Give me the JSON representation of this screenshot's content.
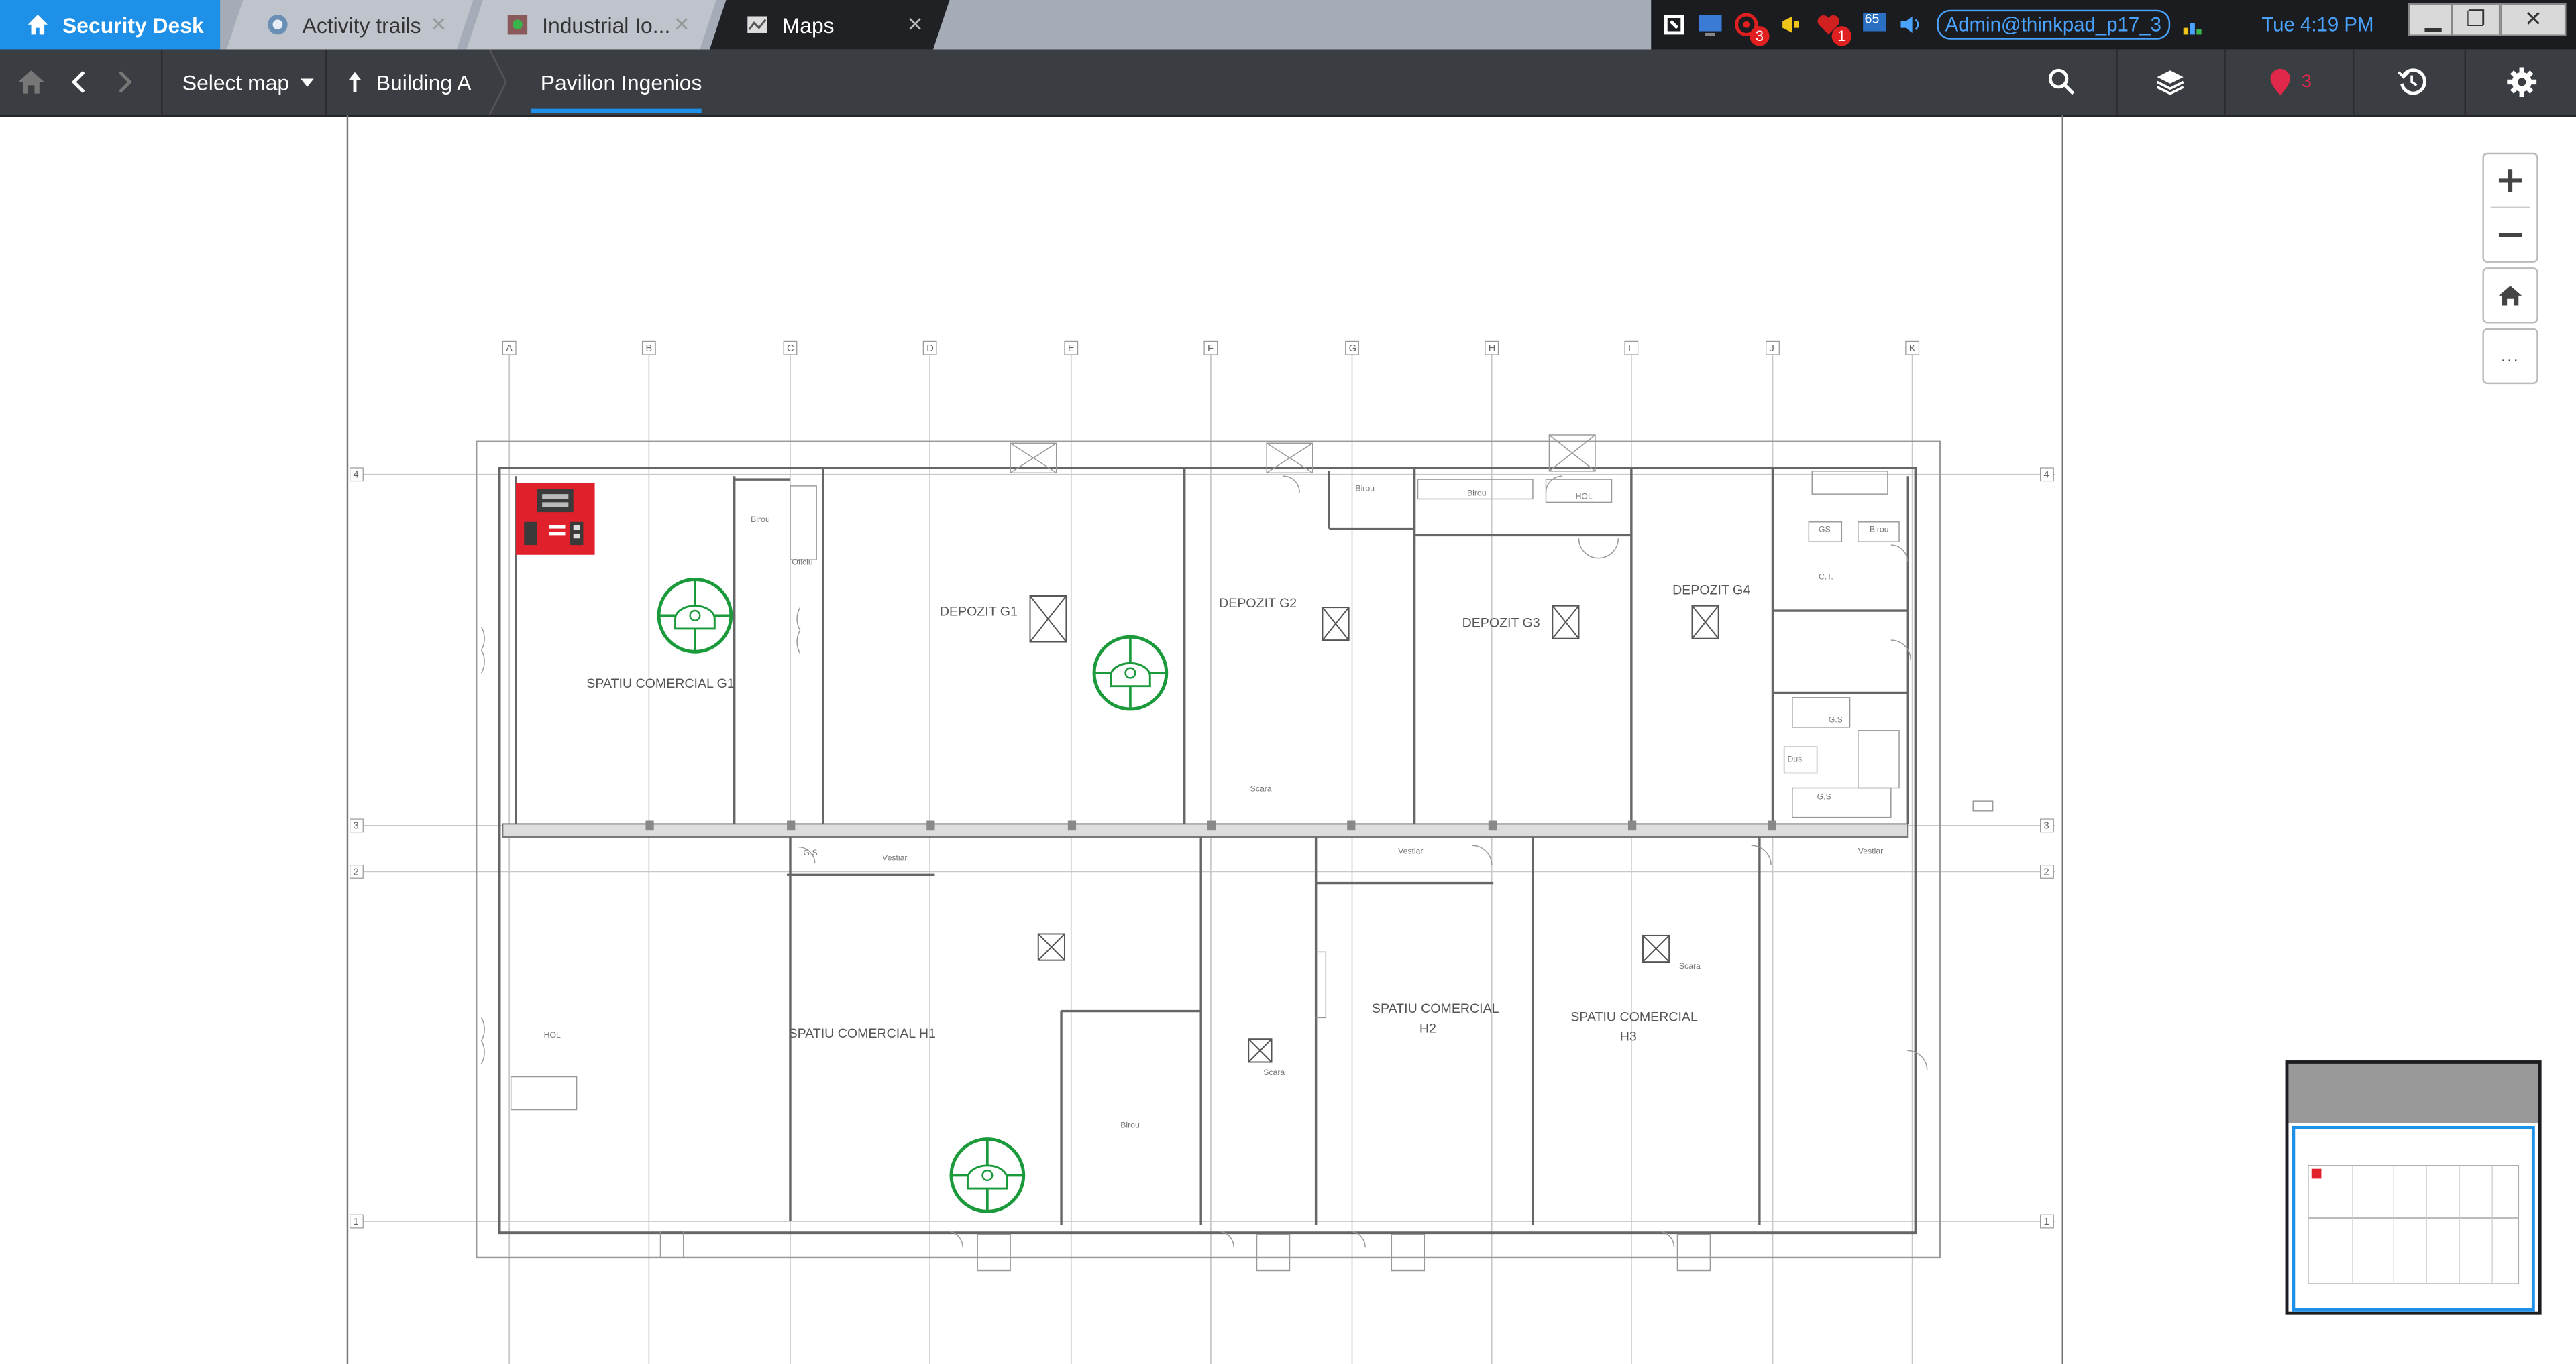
{
  "tabs": {
    "home": {
      "label": "Security Desk"
    },
    "activity": {
      "label": "Activity trails"
    },
    "industrial": {
      "label": "Industrial Io..."
    },
    "maps": {
      "label": "Maps"
    }
  },
  "tray": {
    "alarm_count": "3",
    "notification_count": "1",
    "temperature": "65",
    "user": "Admin@thinkpad_p17_3",
    "clock": "Tue 4:19 PM"
  },
  "toolbar": {
    "select_map_label": "Select map",
    "breadcrumb_parent": "Building A",
    "breadcrumb_current": "Pavilion Ingenios",
    "alarm_count": "3"
  },
  "floorplan": {
    "rooms": {
      "g1": "SPATIU COMERCIAL G1",
      "depozit_g1": "DEPOZIT G1",
      "depozit_g2": "DEPOZIT G2",
      "depozit_g3": "DEPOZIT G3",
      "depozit_g4": "DEPOZIT G4",
      "h1": "SPATIU COMERCIAL H1",
      "h2_line1": "SPATIU COMERCIAL",
      "h2_line2": "H2",
      "h3_line1": "SPATIU COMERCIAL",
      "h3_line2": "H3"
    },
    "grid_columns": [
      "A",
      "B",
      "C",
      "D",
      "E",
      "F",
      "G",
      "H",
      "I",
      "J",
      "K"
    ],
    "grid_rows": [
      "4",
      "3",
      "2",
      "1"
    ]
  },
  "zoom": {
    "more_label": "..."
  },
  "colors": {
    "accent": "#1e90e8",
    "detector": "#1a9a3a",
    "fire_panel": "#e0202a",
    "alarm": "#e0284a"
  }
}
